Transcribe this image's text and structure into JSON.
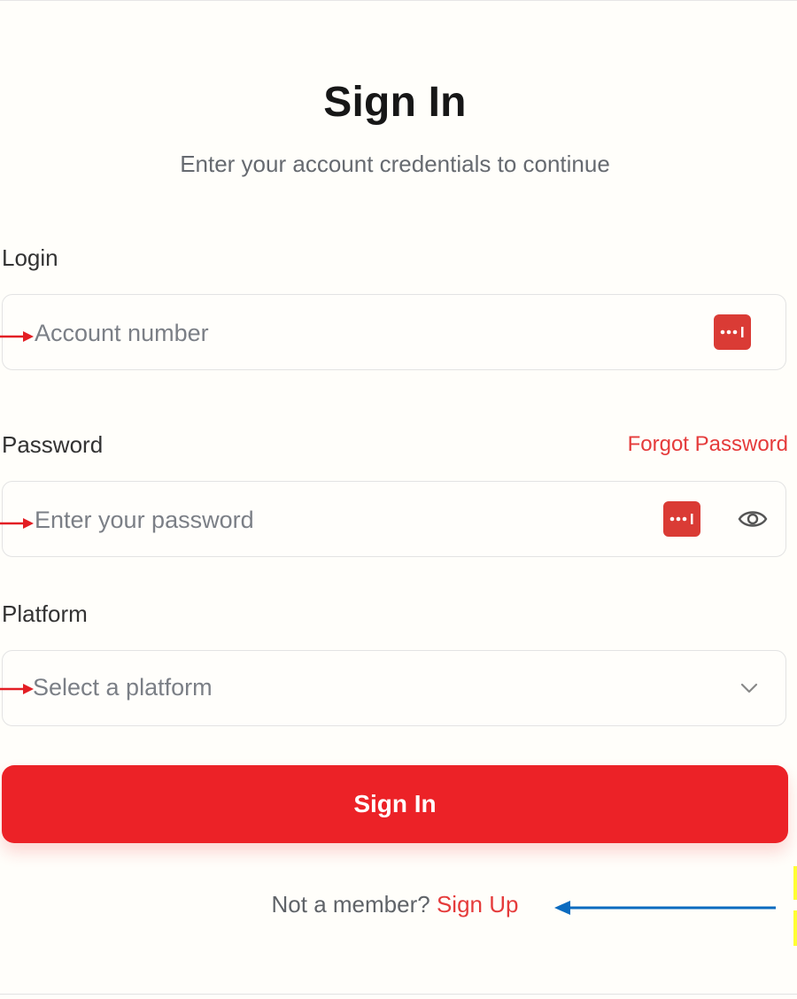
{
  "header": {
    "title": "Sign In",
    "subtitle": "Enter your account credentials to continue"
  },
  "form": {
    "login": {
      "label": "Login",
      "placeholder": "Account number",
      "value": ""
    },
    "password": {
      "label": "Password",
      "placeholder": "Enter your password",
      "value": "",
      "forgot_label": "Forgot Password"
    },
    "platform": {
      "label": "Platform",
      "placeholder": "Select a platform"
    },
    "submit_label": "Sign In"
  },
  "footer": {
    "prompt": "Not a member?",
    "signup_label": "Sign Up"
  },
  "icons": {
    "password_manager": "password-manager-icon",
    "show_password": "eye-icon",
    "dropdown": "chevron-down-icon"
  },
  "colors": {
    "accent": "#ec2227",
    "link": "#e53b3b",
    "password_manager_badge": "#da3b35",
    "annotation_red": "#e31e24",
    "annotation_blue": "#0b6bbf",
    "annotation_yellow": "#ffff33"
  }
}
